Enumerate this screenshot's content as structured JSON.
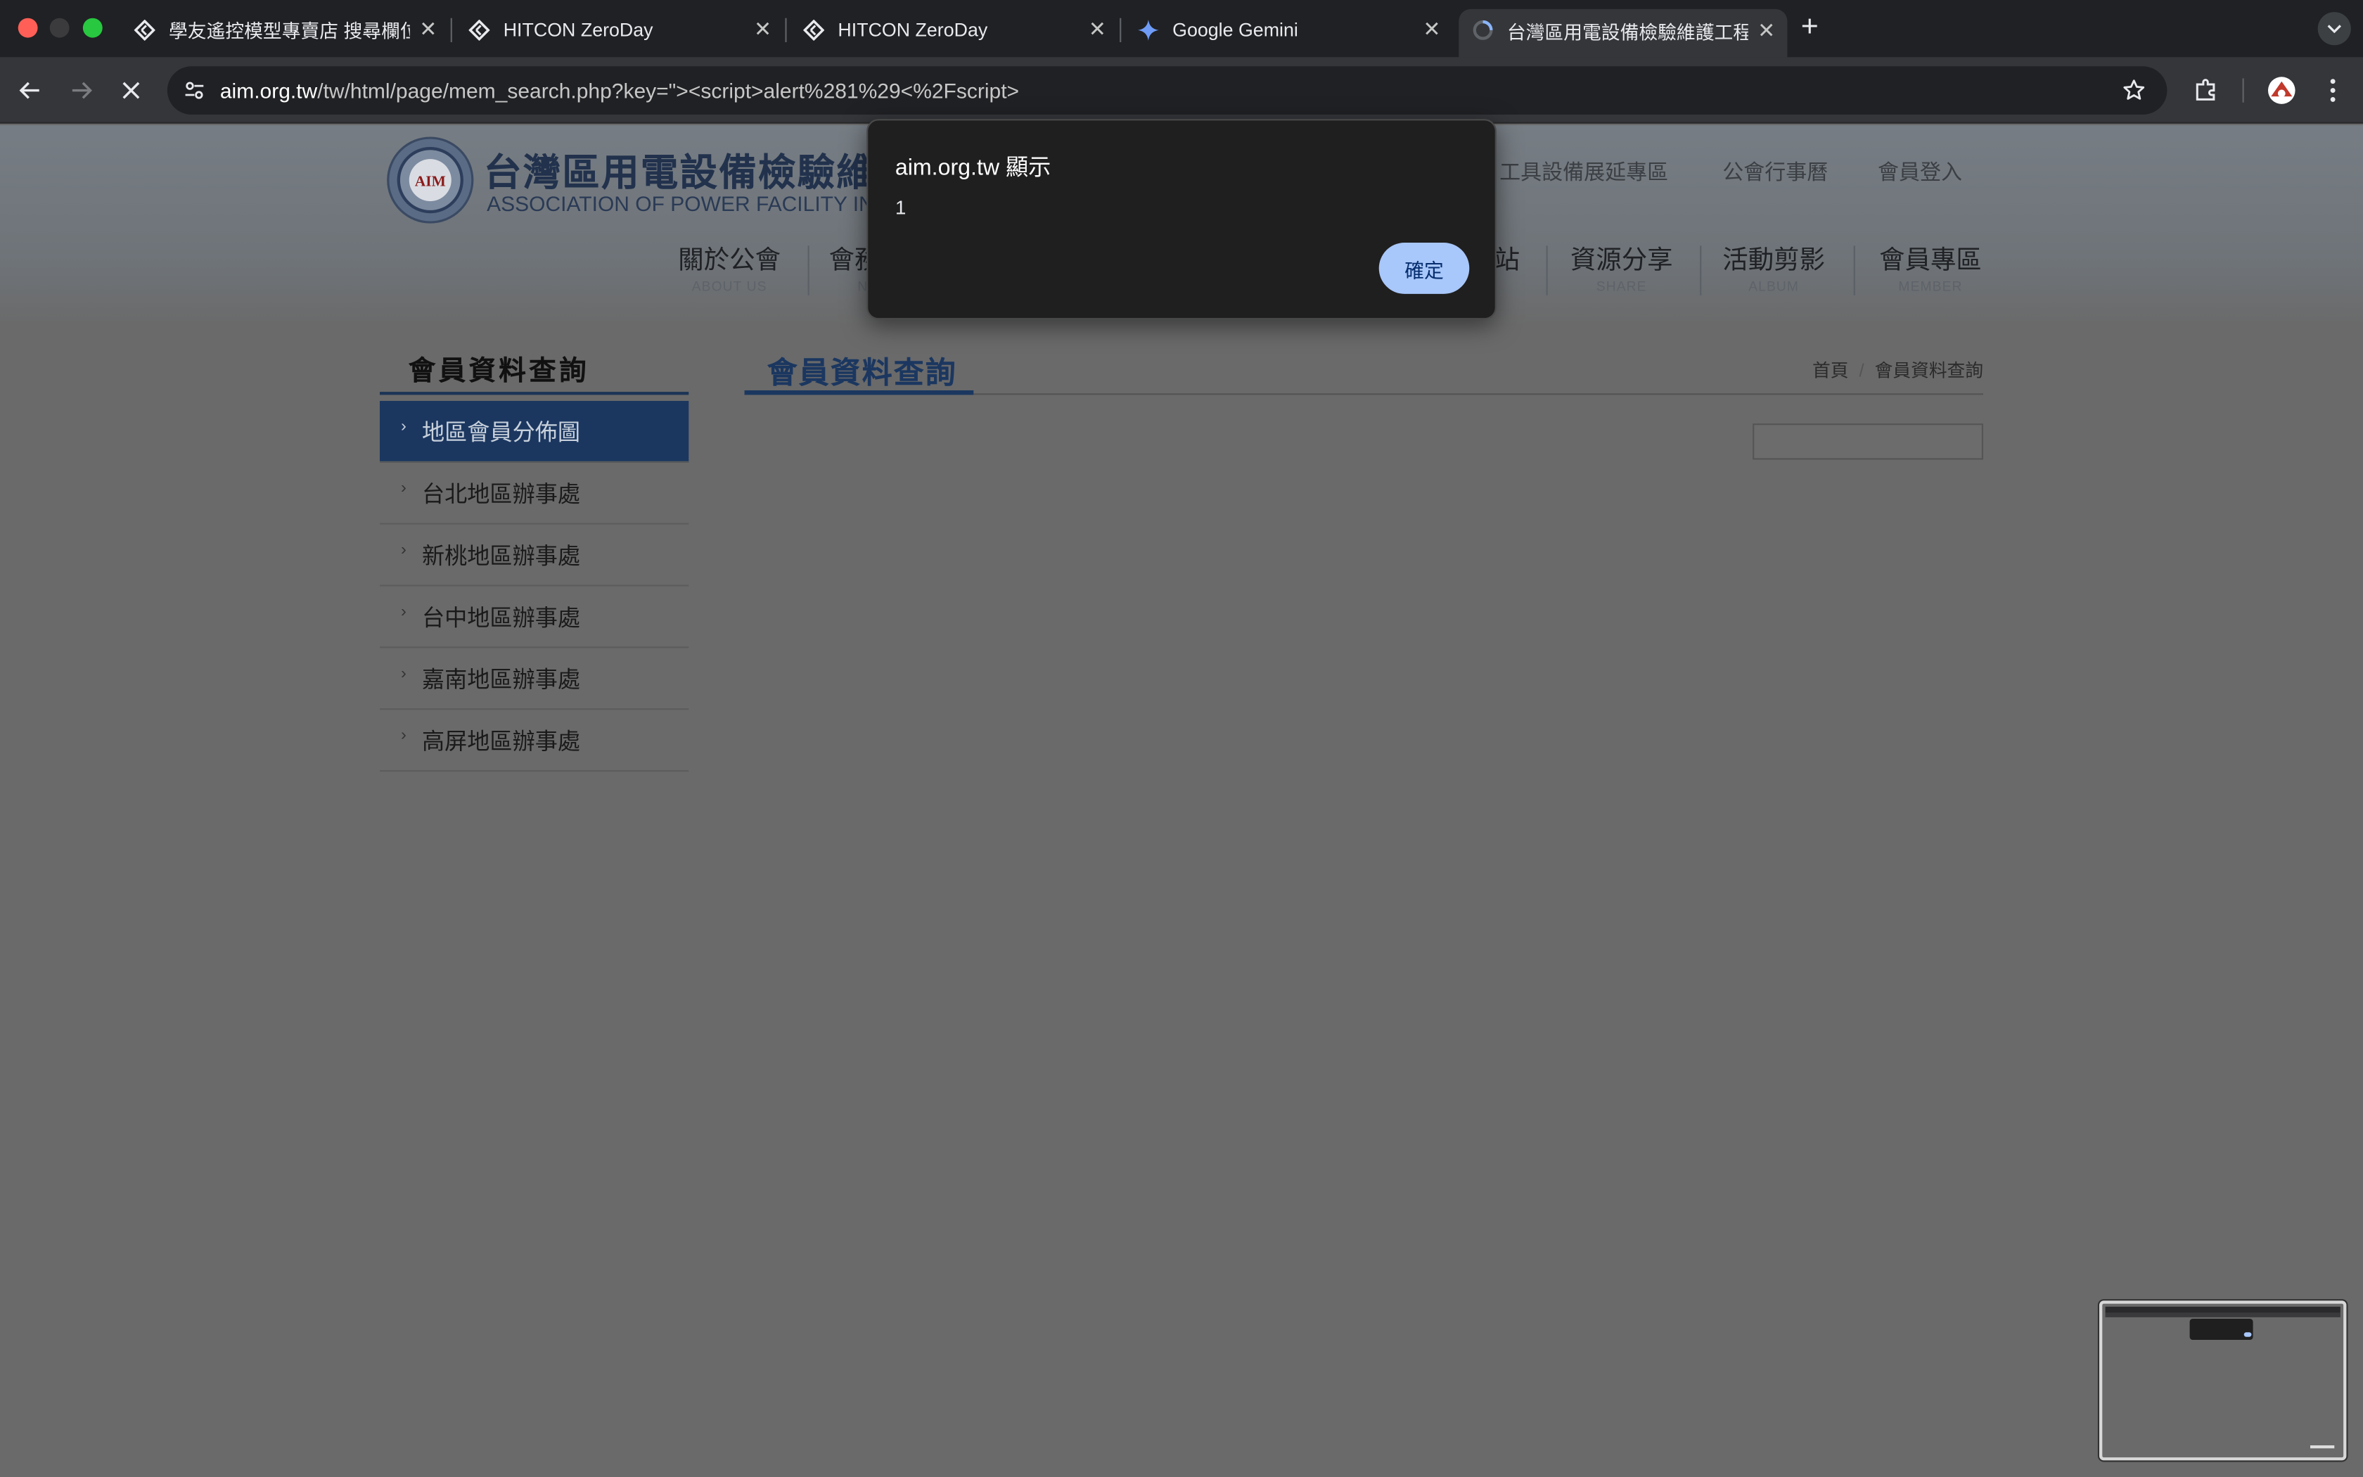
{
  "browser": {
    "tabs": [
      {
        "title": "學友遙控模型專賣店 搜尋欄位 >",
        "icon": "hitcon-icon"
      },
      {
        "title": "HITCON ZeroDay",
        "icon": "hitcon-icon"
      },
      {
        "title": "HITCON ZeroDay",
        "icon": "hitcon-icon"
      },
      {
        "title": "Google Gemini",
        "icon": "gemini-icon"
      },
      {
        "title": "台灣區用電設備檢驗維護工程工",
        "icon": "loading-spinner-icon",
        "active": true
      }
    ],
    "new_tab": "+",
    "url_host": "aim.org.tw",
    "url_path": "/tw/html/page/mem_search.php?key=\"><script>alert%281%29<%2Fscript>"
  },
  "site": {
    "logo_badge": "AIM",
    "logo_cn": "台灣區用電設備檢驗維",
    "logo_en": "ASSOCIATION OF POWER FACILITY INSPI",
    "top_links": [
      "工具設備展延專區",
      "公會行事曆",
      "會員登入"
    ],
    "nav": [
      {
        "zh": "關於公會",
        "en": "ABOUT US"
      },
      {
        "zh": "會務",
        "en": "N"
      },
      {
        "zh": "站",
        "en": ""
      },
      {
        "zh": "資源分享",
        "en": "SHARE"
      },
      {
        "zh": "活動剪影",
        "en": "ALBUM"
      },
      {
        "zh": "會員專區",
        "en": "MEMBER"
      }
    ]
  },
  "sidebar": {
    "title": "會員資料查詢",
    "items": [
      {
        "label": "地區會員分佈圖",
        "active": true
      },
      {
        "label": "台北地區辦事處"
      },
      {
        "label": "新桃地區辦事處"
      },
      {
        "label": "台中地區辦事處"
      },
      {
        "label": "嘉南地區辦事處"
      },
      {
        "label": "高屏地區辦事處"
      }
    ]
  },
  "content": {
    "title": "會員資料查詢",
    "breadcrumb": [
      "首頁",
      "會員資料查詢"
    ],
    "breadcrumb_divider": "/",
    "search_value": ""
  },
  "dialog": {
    "title": "aim.org.tw 顯示",
    "message": "1",
    "ok_label": "確定"
  },
  "colors": {
    "accent_navy": "#1b3760",
    "dialog_button": "#a8c7fa",
    "page_dim": "#6a6a6a"
  }
}
